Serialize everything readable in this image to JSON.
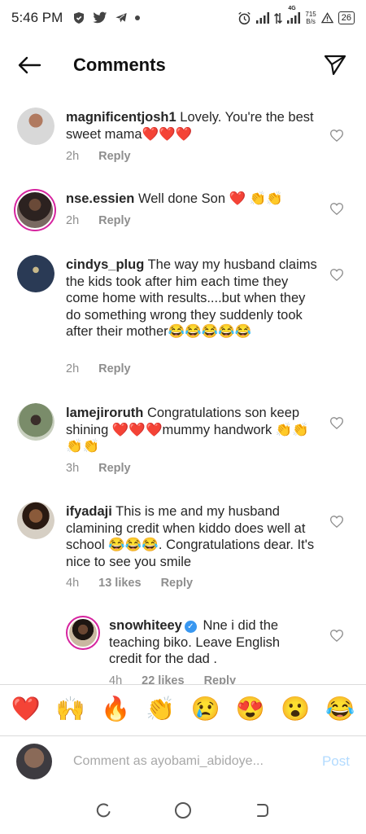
{
  "status_bar": {
    "time": "5:46 PM",
    "network_type": "4G",
    "net_speed_value": "715",
    "net_speed_unit": "B/s",
    "battery": "26",
    "icons": [
      "shield-icon",
      "twitter-icon",
      "telegram-icon",
      "dot-icon",
      "alarm-icon",
      "signal-icon",
      "data-arrows-icon",
      "signal-icon",
      "warning-icon",
      "battery-icon"
    ]
  },
  "header": {
    "title": "Comments"
  },
  "comments": [
    {
      "username": "magnificentjosh1",
      "text": "Lovely. You're the best sweet mama❤️❤️❤️",
      "time": "2h",
      "likes": "",
      "reply_label": "Reply"
    },
    {
      "username": "nse.essien",
      "text": "Well done Son ❤️ 👏👏",
      "time": "2h",
      "likes": "",
      "reply_label": "Reply"
    },
    {
      "username": "cindys_plug",
      "text": "The way my husband claims the kids took after him each time they come home with results....but when they do something wrong they suddenly took after their mother😂😂😂😂😂",
      "time": "2h",
      "likes": "",
      "reply_label": "Reply"
    },
    {
      "username": "lamejiroruth",
      "text": "Congratulations son keep shining ❤️❤️❤️mummy handwork 👏👏👏👏",
      "time": "3h",
      "likes": "",
      "reply_label": "Reply"
    },
    {
      "username": "ifyadaji",
      "text": "This is me and my husband clamining credit when kiddo does well at school 😂😂😂. Congratulations dear. It's nice to see you smile",
      "time": "4h",
      "likes": "13 likes",
      "reply_label": "Reply"
    },
    {
      "username": "snowhiteey",
      "text": "Nne i did the teaching biko. Leave English credit for the dad .",
      "time": "4h",
      "likes": "22 likes",
      "reply_label": "Reply",
      "verified": true
    }
  ],
  "emoji_bar": [
    "❤️",
    "🙌",
    "🔥",
    "👏",
    "😢",
    "😍",
    "😮",
    "😂"
  ],
  "comment_input": {
    "placeholder": "Comment as ayobami_abidoye...",
    "value": ""
  },
  "post_label": "Post",
  "colors": {
    "text": "#262626",
    "meta": "#8e8e8e",
    "post_disabled": "#b3dbff",
    "verified": "#3897f0",
    "story_ring": "#d6249f"
  }
}
